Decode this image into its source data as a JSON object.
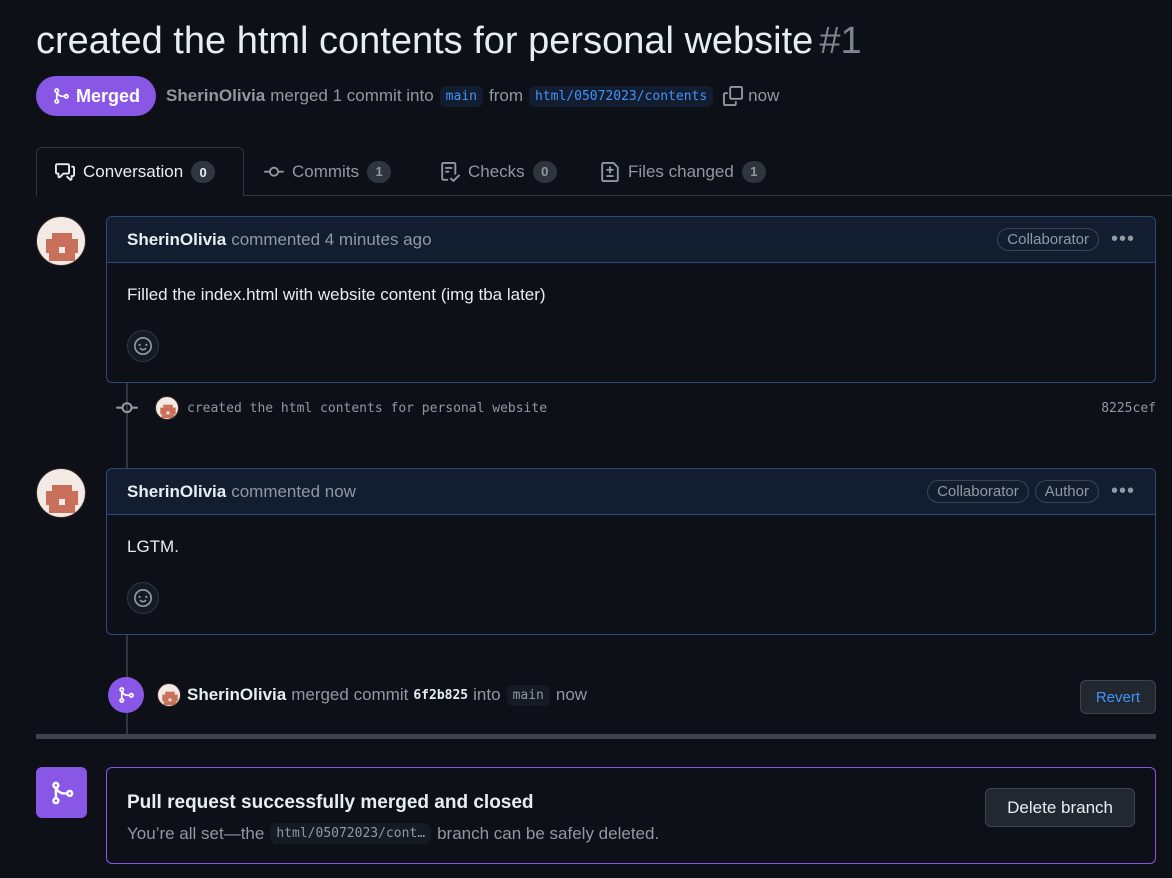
{
  "pr": {
    "title": "created the html contents for personal website",
    "number": "#1",
    "state": "Merged",
    "author": "SherinOlivia",
    "summary_text": "merged 1 commit into",
    "base_branch": "main",
    "from_text": "from",
    "head_branch": "html/05072023/contents",
    "time": "now"
  },
  "tabs": [
    {
      "label": "Conversation",
      "count": "0",
      "icon": "comment-discussion-icon"
    },
    {
      "label": "Commits",
      "count": "1",
      "icon": "git-commit-icon"
    },
    {
      "label": "Checks",
      "count": "0",
      "icon": "checklist-icon"
    },
    {
      "label": "Files changed",
      "count": "1",
      "icon": "file-diff-icon"
    }
  ],
  "comments": [
    {
      "author": "SherinOlivia",
      "action": "commented 4 minutes ago",
      "labels": [
        "Collaborator"
      ],
      "body": "Filled the index.html with website content (img tba later)"
    },
    {
      "author": "SherinOlivia",
      "action": "commented now",
      "labels": [
        "Collaborator",
        "Author"
      ],
      "body": "LGTM."
    }
  ],
  "commit": {
    "message": "created the html contents for personal website",
    "sha": "8225cef"
  },
  "merge_event": {
    "author": "SherinOlivia",
    "text1": "merged commit",
    "hash": "6f2b825",
    "text2": "into",
    "branch": "main",
    "time": "now",
    "revert_label": "Revert"
  },
  "merge_status": {
    "heading": "Pull request successfully merged and closed",
    "sub_prefix": "You’re all set—the",
    "branch": "html/05072023/cont…",
    "sub_suffix": "branch can be safely deleted.",
    "delete_label": "Delete branch"
  },
  "colors": {
    "merged": "#8957e5",
    "link": "#4493f8",
    "background": "#0d1117"
  }
}
